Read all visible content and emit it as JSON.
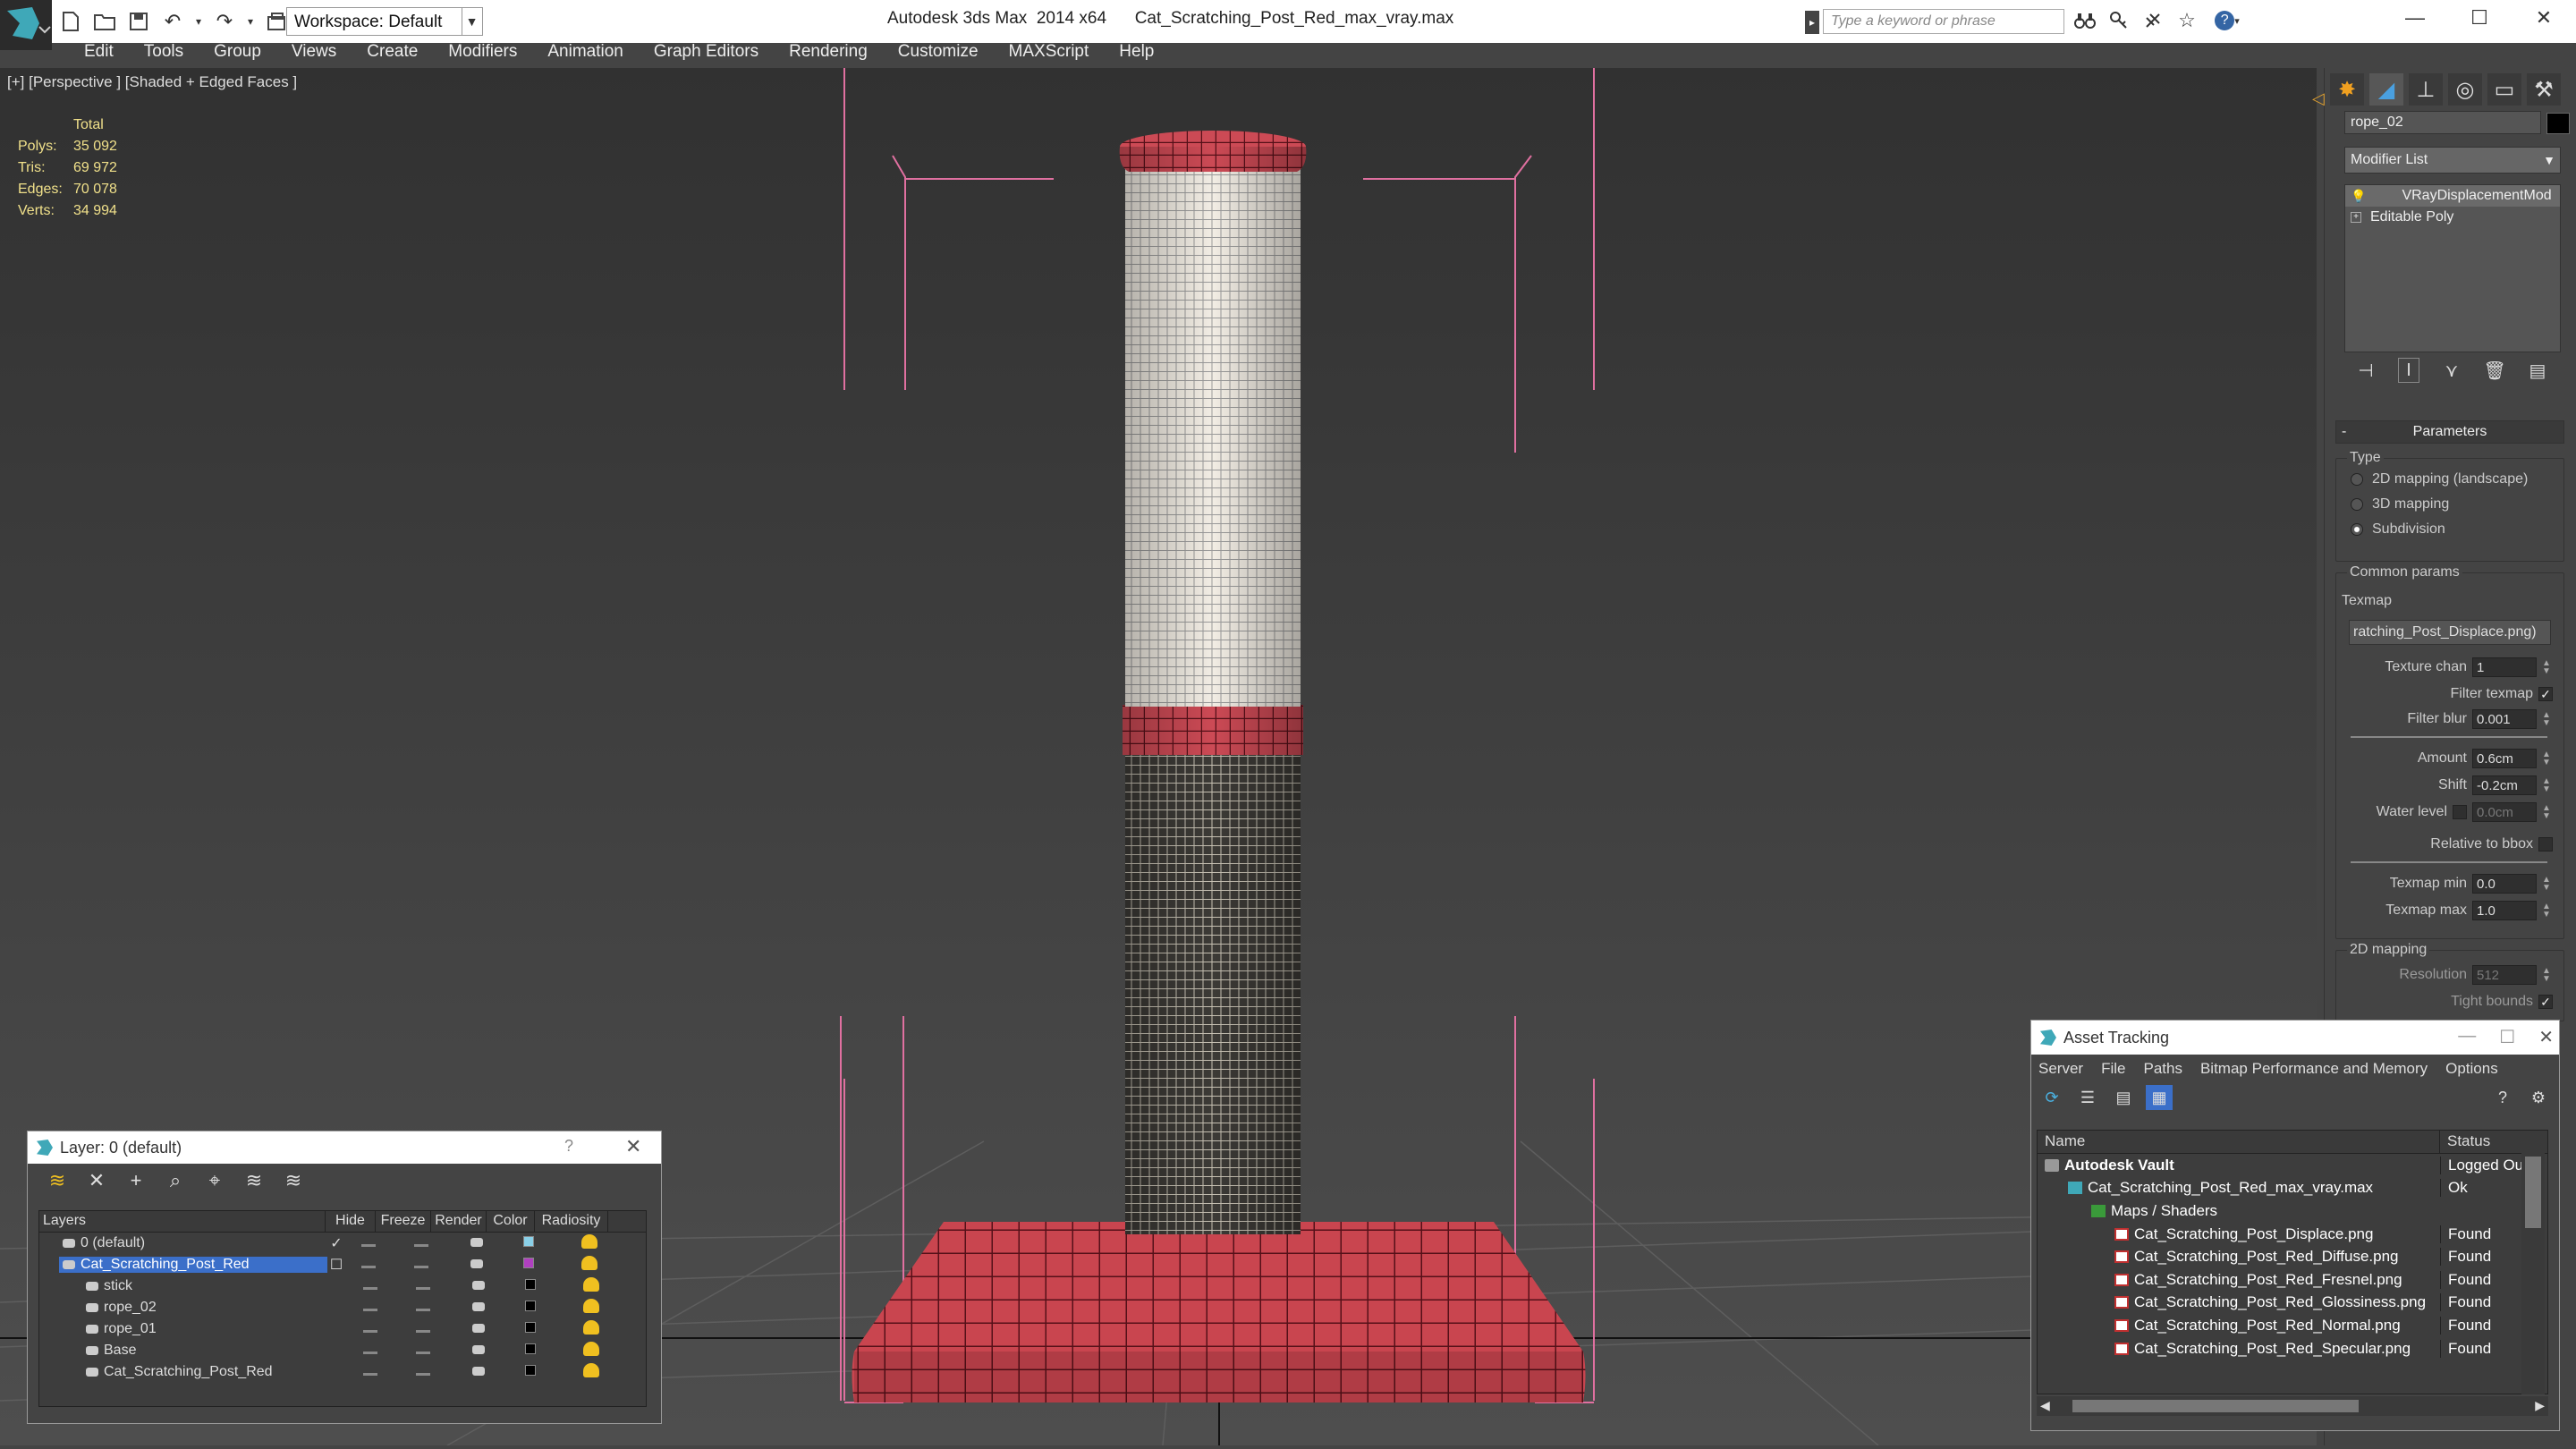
{
  "titlebar": {
    "app_title": "Autodesk 3ds Max  2014 x64      Cat_Scratching_Post_Red_max_vray.max",
    "workspace": "Workspace: Default",
    "search_placeholder": "Type a keyword or phrase"
  },
  "menu": [
    "Edit",
    "Tools",
    "Group",
    "Views",
    "Create",
    "Modifiers",
    "Animation",
    "Graph Editors",
    "Rendering",
    "Customize",
    "MAXScript",
    "Help"
  ],
  "viewport": {
    "label": "[+] [Perspective ] [Shaded + Edged Faces ]",
    "stats": {
      "total_label": "Total",
      "rows": [
        {
          "k": "Polys:",
          "v": "35 092"
        },
        {
          "k": "Tris:",
          "v": "69 972"
        },
        {
          "k": "Edges:",
          "v": "70 078"
        },
        {
          "k": "Verts:",
          "v": "34 994"
        }
      ]
    }
  },
  "command_panel": {
    "object_name": "rope_02",
    "modifier_list": "Modifier List",
    "stack": [
      "VRayDisplacementMod",
      "Editable Poly"
    ],
    "rollout": "Parameters",
    "type_group": "Type",
    "types": [
      "2D mapping (landscape)",
      "3D mapping",
      "Subdivision"
    ],
    "selected_type": "Subdivision",
    "common_group": "Common params",
    "texmap_label": "Texmap",
    "texmap_value": "ratching_Post_Displace.png)",
    "texture_chan_label": "Texture chan",
    "texture_chan": "1",
    "filter_texmap_label": "Filter texmap",
    "filter_blur_label": "Filter blur",
    "filter_blur": "0.001",
    "amount_label": "Amount",
    "amount": "0.6cm",
    "shift_label": "Shift",
    "shift": "-0.2cm",
    "water_level_label": "Water level",
    "water_level": "0.0cm",
    "relative_bbox_label": "Relative to bbox",
    "texmap_min_label": "Texmap min",
    "texmap_min": "0.0",
    "texmap_max_label": "Texmap max",
    "texmap_max": "1.0",
    "mapping2d_group": "2D mapping",
    "resolution_label": "Resolution",
    "resolution": "512",
    "tight_bounds_label": "Tight bounds"
  },
  "layer_window": {
    "title": "Layer: 0 (default)",
    "help": "?",
    "columns": [
      "Layers",
      "Hide",
      "Freeze",
      "Render",
      "Color",
      "Radiosity"
    ],
    "rows": [
      {
        "name": "0 (default)",
        "color": "#8ad0e8",
        "indent": 1
      },
      {
        "name": "Cat_Scratching_Post_Red",
        "color": "#b040c0",
        "indent": 1,
        "selected": true
      },
      {
        "name": "stick",
        "color": "#000000",
        "indent": 2
      },
      {
        "name": "rope_02",
        "color": "#000000",
        "indent": 2
      },
      {
        "name": "rope_01",
        "color": "#000000",
        "indent": 2
      },
      {
        "name": "Base",
        "color": "#000000",
        "indent": 2
      },
      {
        "name": "Cat_Scratching_Post_Red",
        "color": "#000000",
        "indent": 2
      }
    ]
  },
  "asset_tracking": {
    "title": "Asset Tracking",
    "menu": [
      "Server",
      "File",
      "Paths",
      "Bitmap Performance and Memory",
      "Options"
    ],
    "columns": [
      "Name",
      "Status"
    ],
    "rows": [
      {
        "name": "Autodesk Vault",
        "status": "Logged Out",
        "indent": 1,
        "bold": true
      },
      {
        "name": "Cat_Scratching_Post_Red_max_vray.max",
        "status": "Ok",
        "indent": 2
      },
      {
        "name": "Maps / Shaders",
        "status": "",
        "indent": 3
      },
      {
        "name": "Cat_Scratching_Post_Displace.png",
        "status": "Found",
        "indent": 4
      },
      {
        "name": "Cat_Scratching_Post_Red_Diffuse.png",
        "status": "Found",
        "indent": 4
      },
      {
        "name": "Cat_Scratching_Post_Red_Fresnel.png",
        "status": "Found",
        "indent": 4
      },
      {
        "name": "Cat_Scratching_Post_Red_Glossiness.png",
        "status": "Found",
        "indent": 4
      },
      {
        "name": "Cat_Scratching_Post_Red_Normal.png",
        "status": "Found",
        "indent": 4
      },
      {
        "name": "Cat_Scratching_Post_Red_Specular.png",
        "status": "Found",
        "indent": 4
      }
    ]
  }
}
